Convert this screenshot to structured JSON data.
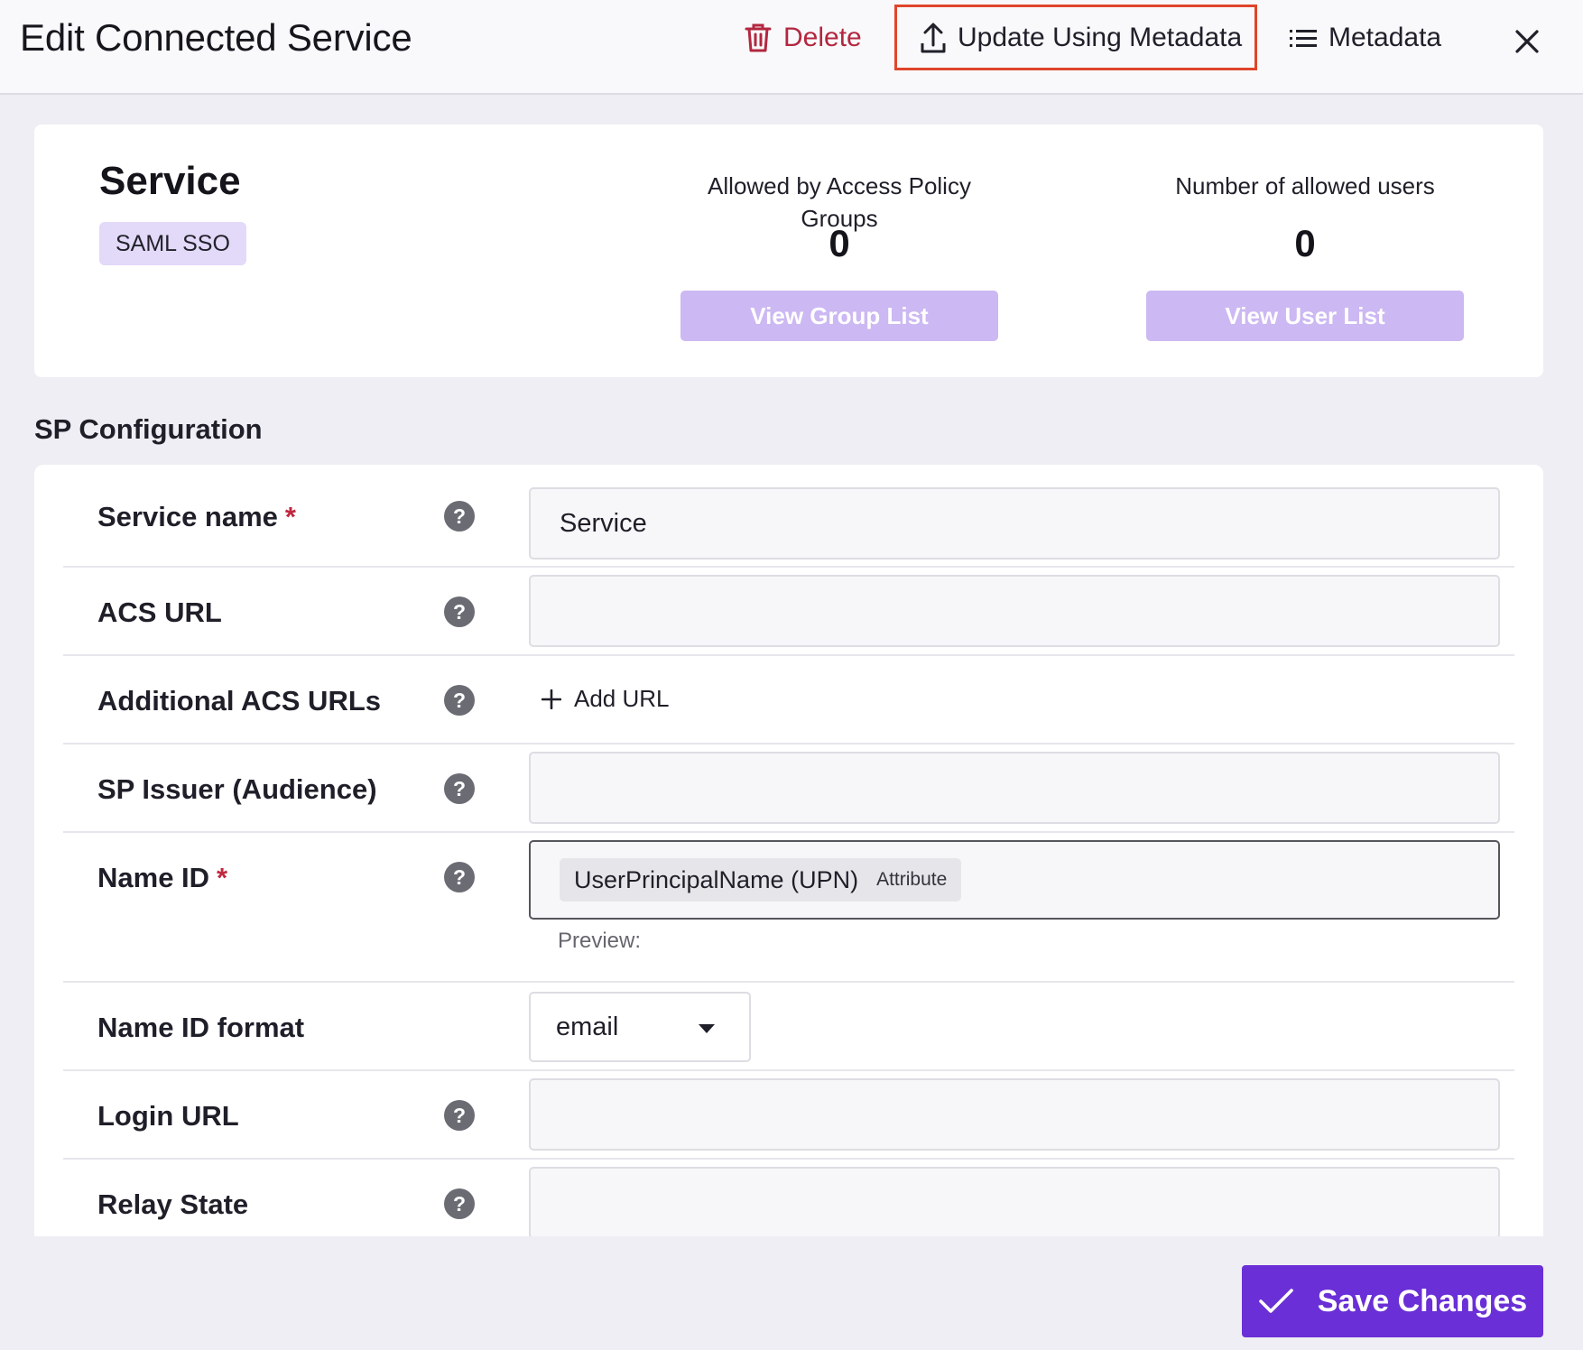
{
  "header": {
    "title": "Edit Connected Service",
    "delete_label": "Delete",
    "update_label": "Update Using Metadata",
    "metadata_label": "Metadata"
  },
  "service": {
    "name": "Service",
    "type_badge": "SAML SSO",
    "groups_label": "Allowed by Access Policy Groups",
    "groups_count": "0",
    "groups_button": "View Group List",
    "users_label": "Number of allowed users",
    "users_count": "0",
    "users_button": "View User List"
  },
  "sp_config": {
    "heading": "SP Configuration",
    "service_name": {
      "label": "Service name",
      "required": "*",
      "value": "Service"
    },
    "acs_url": {
      "label": "ACS URL",
      "value": ""
    },
    "additional_acs": {
      "label": "Additional ACS URLs",
      "add_label": "Add URL"
    },
    "sp_issuer": {
      "label": "SP Issuer (Audience)",
      "value": ""
    },
    "name_id": {
      "label": "Name ID",
      "required": "*",
      "chip_value": "UserPrincipalName (UPN)",
      "chip_tag": "Attribute",
      "preview_label": "Preview:"
    },
    "name_id_format": {
      "label": "Name ID format",
      "selected": "email"
    },
    "login_url": {
      "label": "Login URL",
      "value": ""
    },
    "relay_state": {
      "label": "Relay State",
      "value": ""
    }
  },
  "footer": {
    "save_label": "Save Changes"
  },
  "colors": {
    "accent": "#6a2fd6",
    "accent_light": "#ccb8f2",
    "danger": "#b3273f",
    "highlight_border": "#e0452b",
    "badge_bg": "#e3d9f8"
  },
  "icons": {
    "delete": "trash-icon",
    "update": "upload-icon",
    "metadata": "list-icon",
    "close": "close-icon",
    "help": "help-icon",
    "add": "plus-icon",
    "dropdown": "caret-down-icon",
    "save": "check-icon"
  }
}
